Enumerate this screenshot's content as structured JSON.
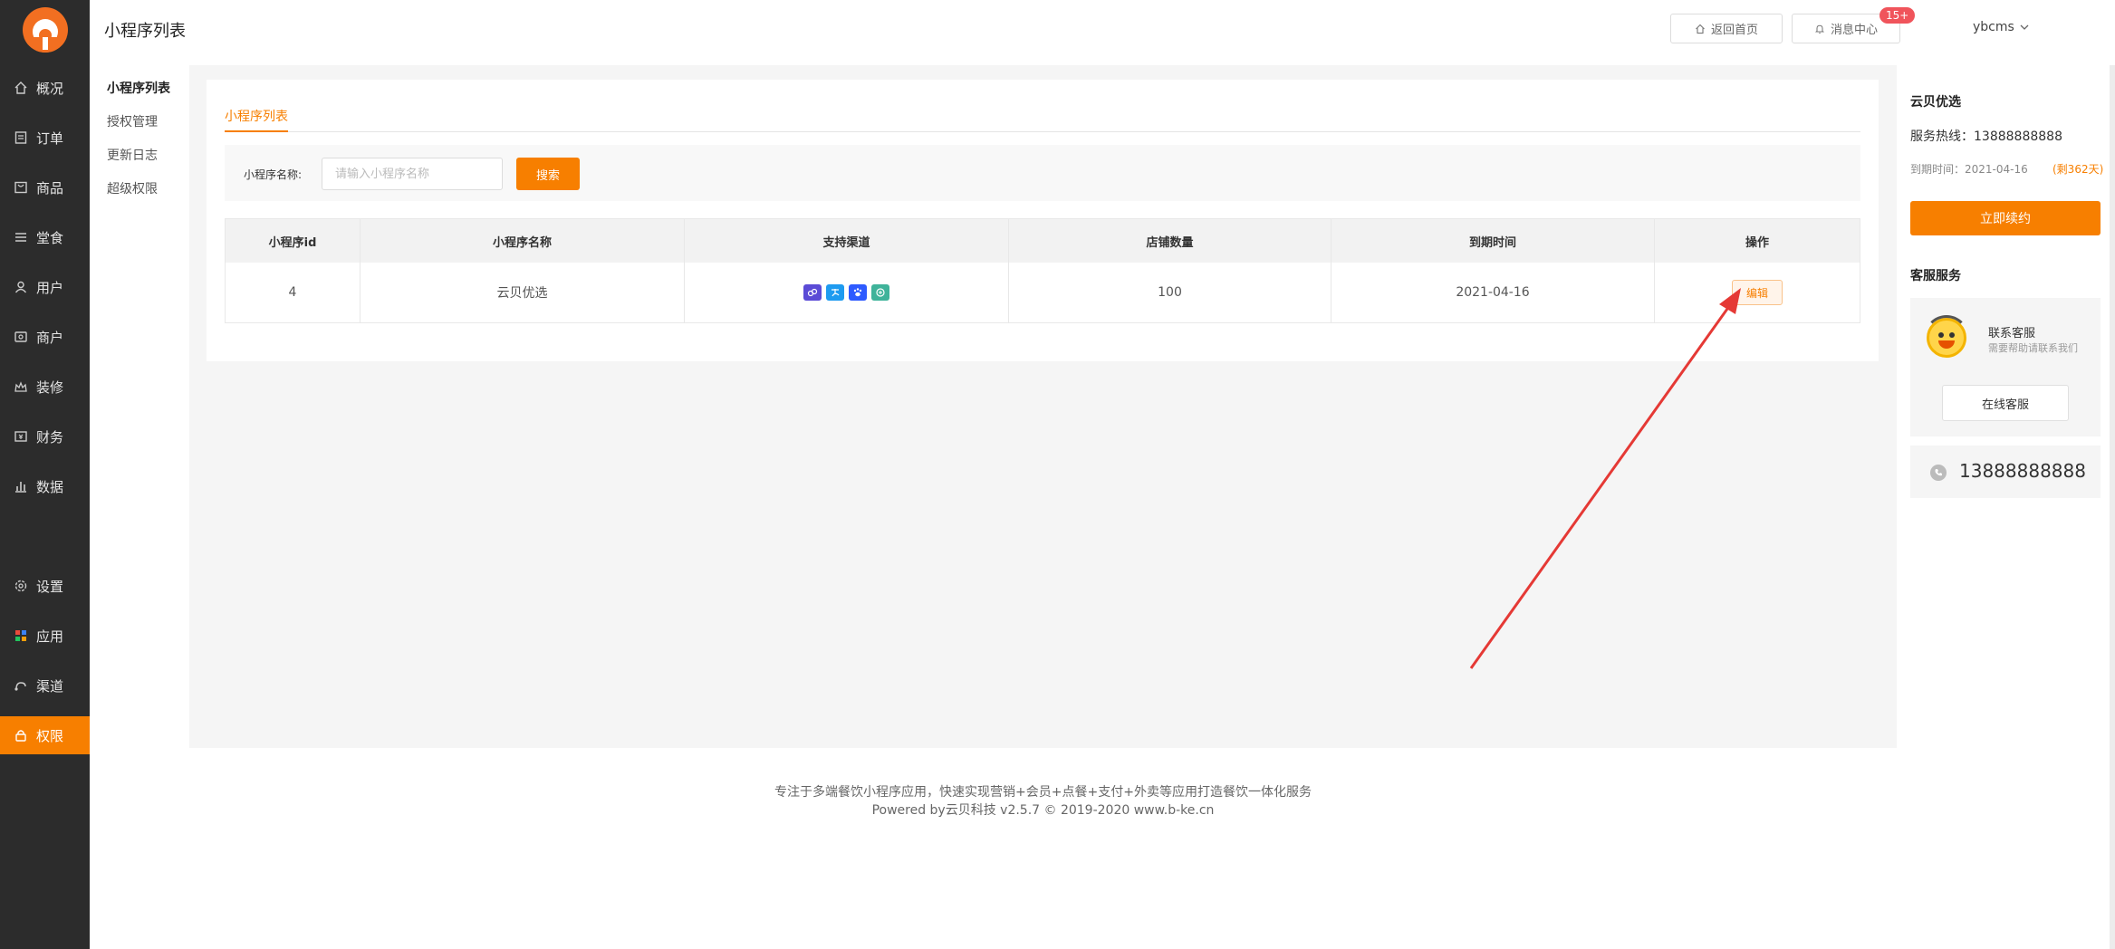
{
  "sidebar": {
    "items": [
      {
        "label": "概况",
        "icon": "home-icon"
      },
      {
        "label": "订单",
        "icon": "order-icon"
      },
      {
        "label": "商品",
        "icon": "goods-icon"
      },
      {
        "label": "堂食",
        "icon": "menu-icon"
      },
      {
        "label": "用户",
        "icon": "user-icon"
      },
      {
        "label": "商户",
        "icon": "merchant-icon"
      },
      {
        "label": "装修",
        "icon": "decorate-icon"
      },
      {
        "label": "财务",
        "icon": "finance-icon"
      },
      {
        "label": "数据",
        "icon": "chart-icon"
      },
      {
        "label": "设置",
        "icon": "gear-icon"
      },
      {
        "label": "应用",
        "icon": "apps-icon"
      },
      {
        "label": "渠道",
        "icon": "channel-icon"
      },
      {
        "label": "权限",
        "icon": "lock-icon"
      }
    ],
    "active": "权限"
  },
  "submenu": {
    "items": [
      "小程序列表",
      "授权管理",
      "更新日志",
      "超级权限"
    ]
  },
  "header": {
    "title": "小程序列表",
    "home_label": "返回首页",
    "msg_label": "消息中心",
    "msg_badge": "15+",
    "user": "ybcms"
  },
  "main": {
    "tab": "小程序列表",
    "search_label": "小程序名称:",
    "search_placeholder": "请输入小程序名称",
    "search_button": "搜索",
    "table": {
      "headers": [
        "小程序id",
        "小程序名称",
        "支持渠道",
        "店铺数量",
        "到期时间",
        "操作"
      ],
      "rows": [
        {
          "id": "4",
          "name": "云贝优选",
          "shops": "100",
          "expire": "2021-04-16",
          "action": "编辑"
        }
      ]
    }
  },
  "footer": {
    "line1": "专注于多端餐饮小程序应用，快速实现营销+会员+点餐+支付+外卖等应用打造餐饮一体化服务",
    "line2": "Powered by云贝科技 v2.5.7 © 2019-2020 www.b-ke.cn"
  },
  "right": {
    "title": "云贝优选",
    "hotline": "服务热线：13888888888",
    "expire": "到期时间：2021-04-16",
    "remain": "(剩362天)",
    "renew_button": "立即续约",
    "service_title": "客服服务",
    "svc_title": "联系客服",
    "svc_sub": "需要帮助请联系我们",
    "online_button": "在线客服",
    "phone": "13888888888"
  },
  "colors": {
    "accent": "#f77f00",
    "sidebar_bg": "#2c2c2c",
    "annotation_arrow": "#e53935"
  }
}
